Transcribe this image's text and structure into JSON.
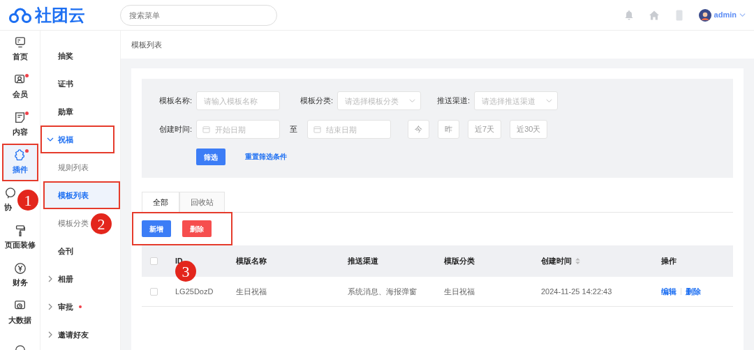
{
  "header": {
    "logo_text": "社团云",
    "search": {
      "placeholder": "搜索菜单"
    },
    "user": "admin"
  },
  "rail": [
    {
      "label": "首页",
      "dot": false,
      "selected": false,
      "outlined": false
    },
    {
      "label": "会员",
      "dot": true,
      "selected": false,
      "outlined": false
    },
    {
      "label": "内容",
      "dot": true,
      "selected": false,
      "outlined": false
    },
    {
      "label": "插件",
      "dot": true,
      "selected": true,
      "outlined": true
    },
    {
      "label": "协",
      "dot": false,
      "selected": false,
      "outlined": false,
      "marker": "1"
    },
    {
      "label": "页面装修",
      "dot": false,
      "selected": false,
      "outlined": false
    },
    {
      "label": "财务",
      "dot": false,
      "selected": false,
      "outlined": false
    },
    {
      "label": "大数据",
      "dot": false,
      "selected": false,
      "outlined": false
    },
    {
      "dot": false,
      "selected": false,
      "outlined": false
    }
  ],
  "submenu": [
    {
      "label": "抽奖",
      "selected": false
    },
    {
      "label": "证书",
      "selected": false
    },
    {
      "label": "勋章",
      "selected": false
    },
    {
      "label": "祝福",
      "expanded": true,
      "outlined": true,
      "children": [
        {
          "label": "规则列表",
          "selected": false,
          "outlined": false
        },
        {
          "label": "模板列表",
          "selected": true,
          "outlined": true
        },
        {
          "label": "模板分类",
          "selected": false,
          "outlined": false,
          "marker": "2"
        }
      ]
    },
    {
      "label": "会刊",
      "selected": false
    },
    {
      "label": "相册",
      "expanded": false,
      "dot": false
    },
    {
      "label": "审批",
      "expanded": false,
      "dot": true
    },
    {
      "label": "邀请好友",
      "expanded": false,
      "dot": false
    }
  ],
  "breadcrumb": "模板列表",
  "filters": [
    {
      "label": "模板名称:",
      "kind": "input",
      "placeholder": "请输入模板名称"
    },
    {
      "label": "模板分类:",
      "kind": "select",
      "placeholder": "请选择模板分类"
    },
    {
      "label": "推送渠道:",
      "kind": "select",
      "placeholder": "请选择推送渠道"
    }
  ],
  "date_filter": {
    "label": "创建时间:",
    "start_placeholder": "开始日期",
    "separator": "至",
    "end_placeholder": "结束日期",
    "quick": [
      "今",
      "昨",
      "近7天",
      "近30天"
    ]
  },
  "filter_button": "筛选",
  "reset_link": "重置筛选条件",
  "tabs": [
    {
      "label": "全部",
      "selected": true
    },
    {
      "label": "回收站",
      "selected": false
    }
  ],
  "actions": {
    "outlined": true,
    "buttons": [
      {
        "label": "新增",
        "kind": "primary"
      },
      {
        "label": "删除",
        "kind": "danger"
      }
    ]
  },
  "table": {
    "all_checked": false,
    "columns": [
      {
        "label": "ID"
      },
      {
        "label": "模版名称"
      },
      {
        "label": "推送渠道"
      },
      {
        "label": "模版分类"
      },
      {
        "label": "创建时间",
        "sortable": true
      },
      {
        "label": "操作"
      }
    ],
    "rows": [
      {
        "checked": false,
        "id": "LG25DozD",
        "marker": "3",
        "name": "生日祝福",
        "channel": "系统消息、海报弹窗",
        "category": "生日祝福",
        "created": "2024-11-25 14:22:43",
        "links": [
          "编辑",
          "删除"
        ]
      }
    ]
  }
}
